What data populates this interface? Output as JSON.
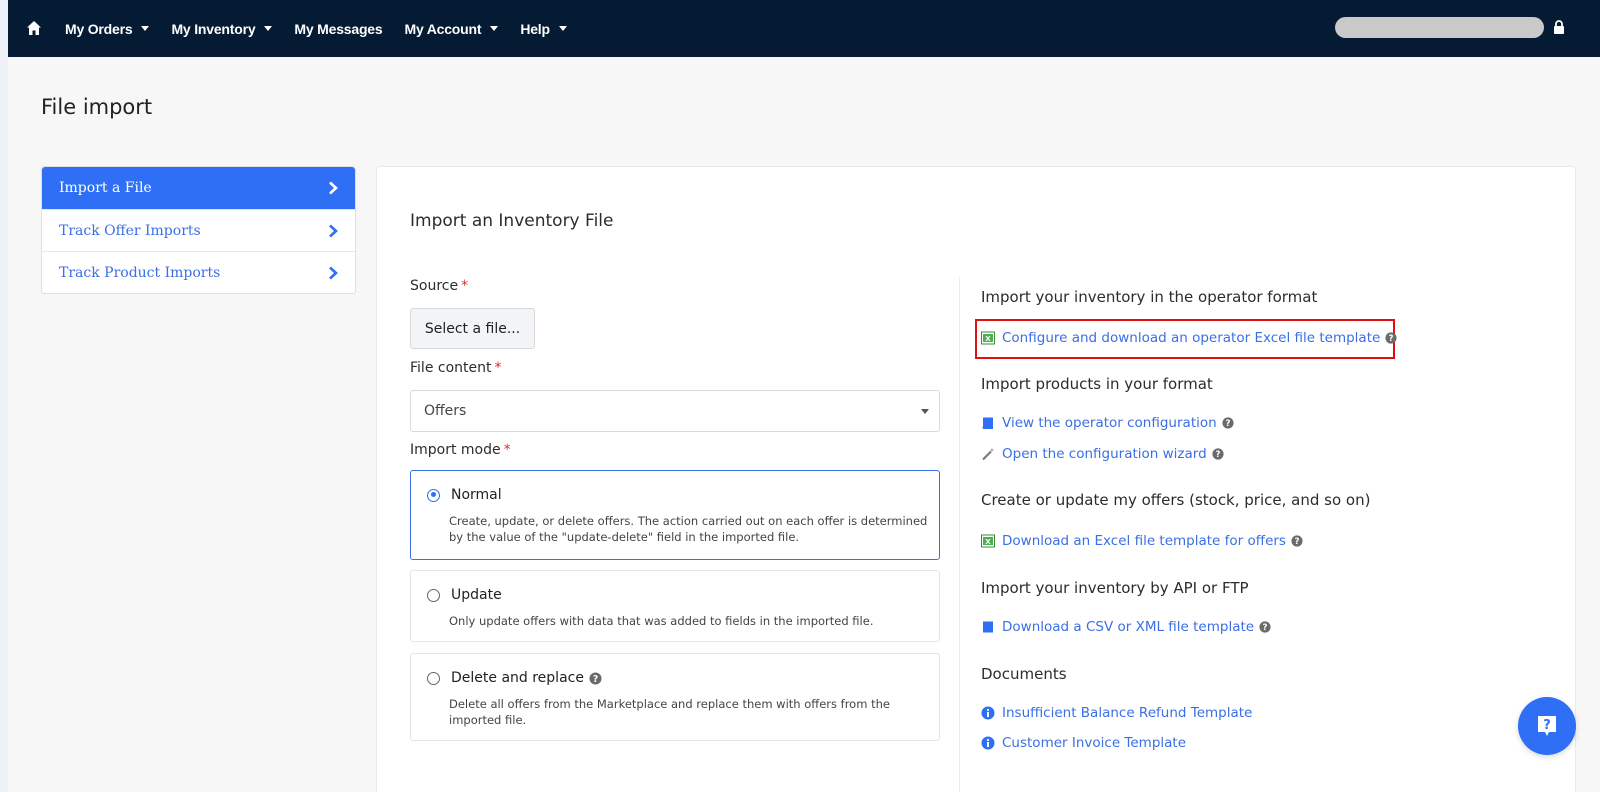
{
  "nav": {
    "items": [
      {
        "label": "My Orders",
        "dropdown": true
      },
      {
        "label": "My Inventory",
        "dropdown": true
      },
      {
        "label": "My Messages",
        "dropdown": false
      },
      {
        "label": "My Account",
        "dropdown": true
      },
      {
        "label": "Help",
        "dropdown": true
      }
    ],
    "icons": {
      "home": "home-icon",
      "lock": "lock-icon"
    },
    "bg": "#041b33"
  },
  "page": {
    "title": "File import"
  },
  "sidebar": {
    "items": [
      {
        "label": "Import a File",
        "active": true
      },
      {
        "label": "Track Offer Imports",
        "active": false
      },
      {
        "label": "Track Product Imports",
        "active": false
      }
    ],
    "accent": "#2f6ff5"
  },
  "form": {
    "title": "Import an Inventory File",
    "source_label": "Source",
    "required_mark": "*",
    "select_file_button": "Select a file...",
    "file_content_label": "File content",
    "file_content_value": "Offers",
    "import_mode_label": "Import mode",
    "modes": [
      {
        "label": "Normal",
        "selected": true,
        "desc": "Create, update, or delete offers. The action carried out on each offer is determined by the value of the \"update-delete\" field in the imported file."
      },
      {
        "label": "Update",
        "selected": false,
        "desc": "Only update offers with data that was added to fields in the imported file."
      },
      {
        "label": "Delete and replace",
        "selected": false,
        "desc": "Delete all offers from the Marketplace and replace them with offers from the imported file."
      }
    ]
  },
  "right": {
    "sec1": "Import your inventory in the operator format",
    "link1": "Configure and download an operator Excel file template",
    "sec2": "Import products in your format",
    "link2": "View the operator configuration",
    "link3": "Open the configuration wizard",
    "sec3": "Create or update my offers (stock, price, and so on)",
    "link4": "Download an Excel file template for offers",
    "sec4": "Import your inventory by API or FTP",
    "link5": "Download a CSV or XML file template",
    "sec5": "Documents",
    "doc1": "Insufficient Balance Refund Template",
    "doc2": "Customer Invoice Template"
  },
  "colors": {
    "link": "#3a6fe5",
    "highlight": "#e01010",
    "required": "#e02b2b"
  }
}
